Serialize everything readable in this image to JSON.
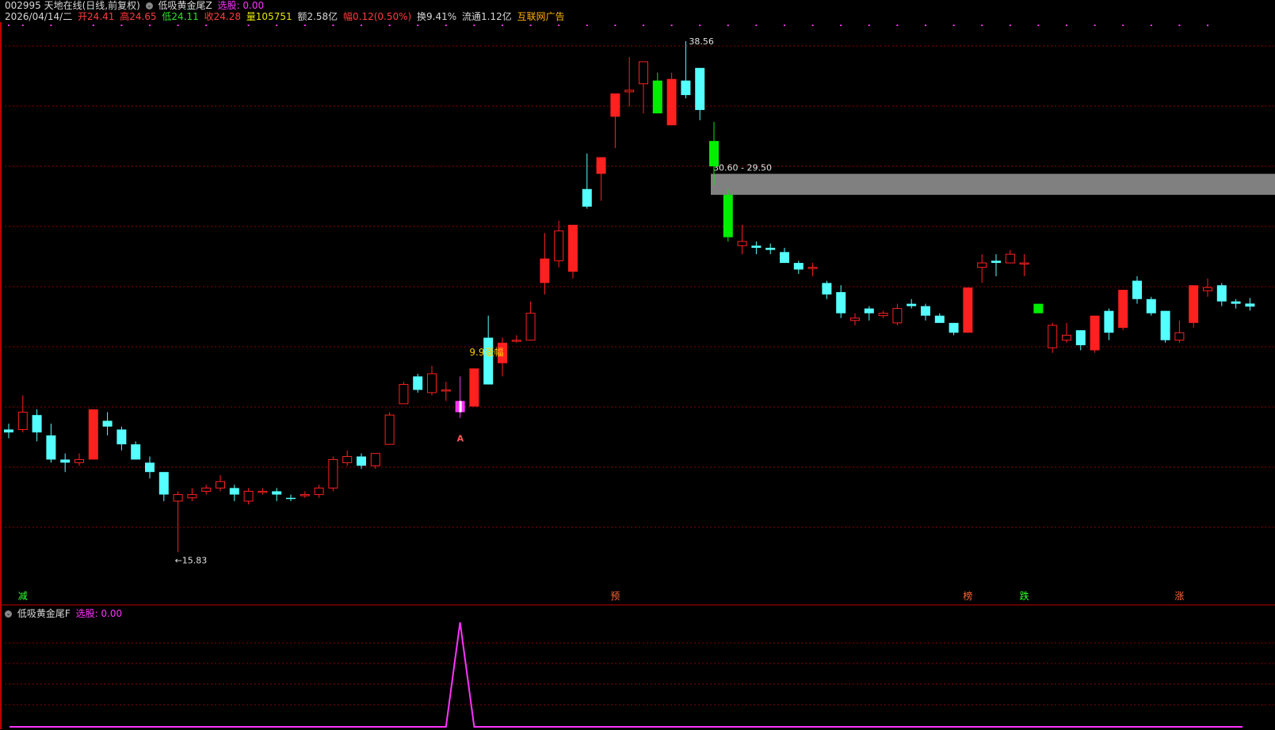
{
  "header": {
    "stock_title": "002995 天地在线(日线,前复权)",
    "indicator_name": "低吸黄金尾Z",
    "select_label": "选股: 0.00",
    "date": "2026/04/14/二",
    "open": "开24.41",
    "high": "高24.65",
    "low": "低24.11",
    "close": "收24.28",
    "volume": "量105751",
    "amount": "额2.58亿",
    "change": "幅0.12(0.50%)",
    "turnover": "换9.41%",
    "float_cap": "流通1.12亿",
    "concept": "互联网广告"
  },
  "sub_header": {
    "indicator_name": "低吸黄金尾F",
    "select_label": "选股: 0.00"
  },
  "icons": {
    "header_dot": "settings-circle-icon",
    "sub_dot": "settings-circle-icon"
  },
  "colors": {
    "up": "#ff2020",
    "down": "#55ffff",
    "signal_green": "#00ee00",
    "line": "#ff33ff",
    "zone": "#808080",
    "grid": "#8b0000"
  },
  "chart_data": {
    "type": "candlestick",
    "ylim": [
      14.5,
      40.5
    ],
    "log_scale": true,
    "candles": [
      [
        19.5,
        19.8,
        19.3,
        19.6,
        "cyan"
      ],
      [
        19.6,
        20.8,
        19.5,
        20.2,
        "hollow"
      ],
      [
        19.5,
        20.3,
        19.2,
        20.1,
        "cyan"
      ],
      [
        18.6,
        19.8,
        18.5,
        19.4,
        "cyan"
      ],
      [
        18.6,
        18.8,
        18.2,
        18.5,
        "cyan"
      ],
      [
        18.5,
        18.8,
        18.4,
        18.6,
        "hollow"
      ],
      [
        18.6,
        20.3,
        18.6,
        20.3,
        "red"
      ],
      [
        19.7,
        20.2,
        19.4,
        19.9,
        "cyan"
      ],
      [
        19.1,
        19.7,
        18.9,
        19.6,
        "cyan"
      ],
      [
        18.6,
        19.2,
        18.6,
        19.1,
        "cyan"
      ],
      [
        18.2,
        18.7,
        18.0,
        18.5,
        "cyan"
      ],
      [
        17.5,
        17.7,
        17.3,
        18.2,
        "cyan"
      ],
      [
        17.3,
        17.6,
        15.83,
        17.5,
        "hollow"
      ],
      [
        17.4,
        17.7,
        17.3,
        17.5,
        "hollow"
      ],
      [
        17.6,
        17.8,
        17.5,
        17.7,
        "hollow"
      ],
      [
        17.7,
        18.1,
        17.6,
        17.9,
        "hollow"
      ],
      [
        17.5,
        17.8,
        17.3,
        17.7,
        "cyan"
      ],
      [
        17.3,
        17.7,
        17.2,
        17.6,
        "hollow"
      ],
      [
        17.6,
        17.7,
        17.5,
        17.6,
        "hollow"
      ],
      [
        17.5,
        17.7,
        17.3,
        17.6,
        "cyan"
      ],
      [
        17.4,
        17.5,
        17.3,
        17.4,
        "cyan"
      ],
      [
        17.5,
        17.6,
        17.4,
        17.5,
        "hollow"
      ],
      [
        17.5,
        17.8,
        17.4,
        17.7,
        "hollow"
      ],
      [
        17.7,
        18.7,
        17.6,
        18.6,
        "hollow"
      ],
      [
        18.5,
        18.9,
        18.4,
        18.7,
        "hollow"
      ],
      [
        18.4,
        18.8,
        18.3,
        18.7,
        "cyan"
      ],
      [
        18.4,
        18.8,
        18.3,
        18.8,
        "hollow"
      ],
      [
        19.1,
        20.2,
        19.1,
        20.1,
        "hollow"
      ],
      [
        20.5,
        21.3,
        20.5,
        21.2,
        "hollow"
      ],
      [
        21.0,
        21.6,
        20.9,
        21.5,
        "cyan"
      ],
      [
        20.9,
        21.9,
        20.8,
        21.6,
        "hollow"
      ],
      [
        21.0,
        21.3,
        20.6,
        21.0,
        "hollow"
      ],
      [
        20.2,
        21.5,
        20.0,
        20.6,
        "magenta"
      ],
      [
        20.4,
        21.8,
        20.4,
        21.8,
        "red"
      ],
      [
        21.2,
        23.9,
        21.2,
        23.0,
        "cyan"
      ],
      [
        22.0,
        23.0,
        21.5,
        22.8,
        "red"
      ],
      [
        22.9,
        23.1,
        22.8,
        22.9,
        "hollow"
      ],
      [
        22.9,
        24.5,
        22.9,
        24.0,
        "hollow"
      ],
      [
        25.3,
        27.6,
        24.8,
        26.4,
        "red"
      ],
      [
        26.3,
        28.2,
        26.0,
        27.7,
        "hollow"
      ],
      [
        25.8,
        27.5,
        25.5,
        28.0,
        "red"
      ],
      [
        29.8,
        31.7,
        28.8,
        28.9,
        "cyan"
      ],
      [
        30.6,
        31.5,
        29.2,
        31.5,
        "red"
      ],
      [
        33.8,
        35.2,
        32.0,
        35.2,
        "red"
      ],
      [
        35.3,
        37.5,
        34.4,
        35.4,
        "hollow"
      ],
      [
        35.8,
        37.2,
        34.0,
        37.2,
        "hollow"
      ],
      [
        36.0,
        36.5,
        34.0,
        34.0,
        "green"
      ],
      [
        33.3,
        36.5,
        33.3,
        36.1,
        "red"
      ],
      [
        35.1,
        38.56,
        34.9,
        36.0,
        "cyan"
      ],
      [
        34.2,
        36.8,
        33.6,
        36.8,
        "cyan"
      ],
      [
        32.4,
        33.5,
        30.0,
        31.0,
        "green"
      ],
      [
        29.5,
        29.8,
        27.2,
        27.4,
        "green"
      ],
      [
        27.0,
        28.0,
        26.6,
        27.2,
        "hollow"
      ],
      [
        26.9,
        27.2,
        26.6,
        27.0,
        "cyan"
      ],
      [
        26.8,
        27.1,
        26.6,
        26.9,
        "cyan"
      ],
      [
        26.2,
        26.9,
        26.2,
        26.7,
        "cyan"
      ],
      [
        25.9,
        26.3,
        25.7,
        26.2,
        "cyan"
      ],
      [
        26.0,
        26.2,
        25.6,
        26.0,
        "hollow"
      ],
      [
        24.8,
        25.4,
        24.6,
        25.3,
        "cyan"
      ],
      [
        24.0,
        25.2,
        23.8,
        24.9,
        "cyan"
      ],
      [
        23.7,
        24.0,
        23.5,
        23.8,
        "hollow"
      ],
      [
        24.0,
        24.3,
        23.7,
        24.2,
        "cyan"
      ],
      [
        23.9,
        24.1,
        23.8,
        24.0,
        "hollow"
      ],
      [
        23.6,
        24.4,
        23.5,
        24.2,
        "hollow"
      ],
      [
        24.3,
        24.6,
        24.2,
        24.4,
        "cyan"
      ],
      [
        23.9,
        24.4,
        23.7,
        24.3,
        "cyan"
      ],
      [
        23.6,
        24.0,
        23.6,
        23.9,
        "cyan"
      ],
      [
        23.2,
        23.6,
        23.1,
        23.6,
        "cyan"
      ],
      [
        23.2,
        25.1,
        23.2,
        25.1,
        "red"
      ],
      [
        26.0,
        26.6,
        25.3,
        26.2,
        "hollow"
      ],
      [
        26.2,
        26.6,
        25.6,
        26.3,
        "cyan"
      ],
      [
        26.2,
        26.8,
        26.2,
        26.6,
        "hollow"
      ],
      [
        26.2,
        26.6,
        25.6,
        26.2,
        "hollow"
      ],
      [
        24.0,
        24.4,
        24.0,
        24.4,
        "green"
      ],
      [
        22.6,
        23.6,
        22.4,
        23.5,
        "hollow"
      ],
      [
        22.9,
        23.6,
        22.8,
        23.1,
        "hollow"
      ],
      [
        22.7,
        23.3,
        22.5,
        23.3,
        "cyan"
      ],
      [
        22.5,
        23.9,
        22.4,
        23.9,
        "red"
      ],
      [
        23.2,
        24.2,
        22.9,
        24.1,
        "cyan"
      ],
      [
        23.4,
        25.0,
        23.3,
        25.0,
        "red"
      ],
      [
        24.6,
        25.6,
        24.4,
        25.4,
        "cyan"
      ],
      [
        24.0,
        24.7,
        23.9,
        24.6,
        "cyan"
      ],
      [
        22.9,
        24.1,
        22.8,
        24.1,
        "cyan"
      ],
      [
        22.9,
        23.7,
        22.8,
        23.2,
        "hollow"
      ],
      [
        23.6,
        25.2,
        23.4,
        25.2,
        "red"
      ],
      [
        24.96,
        25.5,
        24.7,
        25.1,
        "hollow"
      ],
      [
        24.5,
        25.3,
        24.3,
        25.2,
        "cyan"
      ],
      [
        24.4,
        24.6,
        24.2,
        24.5,
        "cyan"
      ],
      [
        24.41,
        24.65,
        24.11,
        24.28,
        "cyan"
      ]
    ],
    "resistance_zone": {
      "label": "30.60 - 29.50",
      "top": 30.6,
      "bottom": 29.5,
      "start_index": 50
    },
    "annotations": {
      "high_label": "38.56",
      "high_index": 48,
      "low_label": "←15.83",
      "low_index": 12,
      "gain_label": "9.9涨幅",
      "gain_index": 33,
      "a_marker": "A",
      "a_index": 32
    },
    "bottom_markers": [
      {
        "text": "减",
        "index": 1,
        "color": "#33ff33"
      },
      {
        "text": "预",
        "index": 43,
        "color": "#ff6633"
      },
      {
        "text": "榜",
        "index": 68,
        "color": "#ff6633"
      },
      {
        "text": "跌",
        "index": 72,
        "color": "#33ff33"
      },
      {
        "text": "涨",
        "index": 83,
        "color": "#ff6633"
      }
    ],
    "top_signal_indices": [
      0,
      1,
      3,
      6,
      8,
      10,
      12,
      14,
      17,
      19,
      21,
      23,
      25,
      27,
      29,
      31,
      33,
      35,
      37,
      39,
      41,
      43,
      45,
      47,
      49,
      51,
      53,
      55,
      57,
      59,
      61,
      63,
      65,
      67,
      69,
      71,
      73,
      75,
      77,
      79,
      81,
      83,
      85
    ],
    "sub_indicator": {
      "name": "低吸黄金尾F",
      "values_index": [
        0,
        31,
        32,
        33,
        88
      ],
      "values": [
        0,
        0,
        1,
        0,
        0
      ]
    }
  }
}
